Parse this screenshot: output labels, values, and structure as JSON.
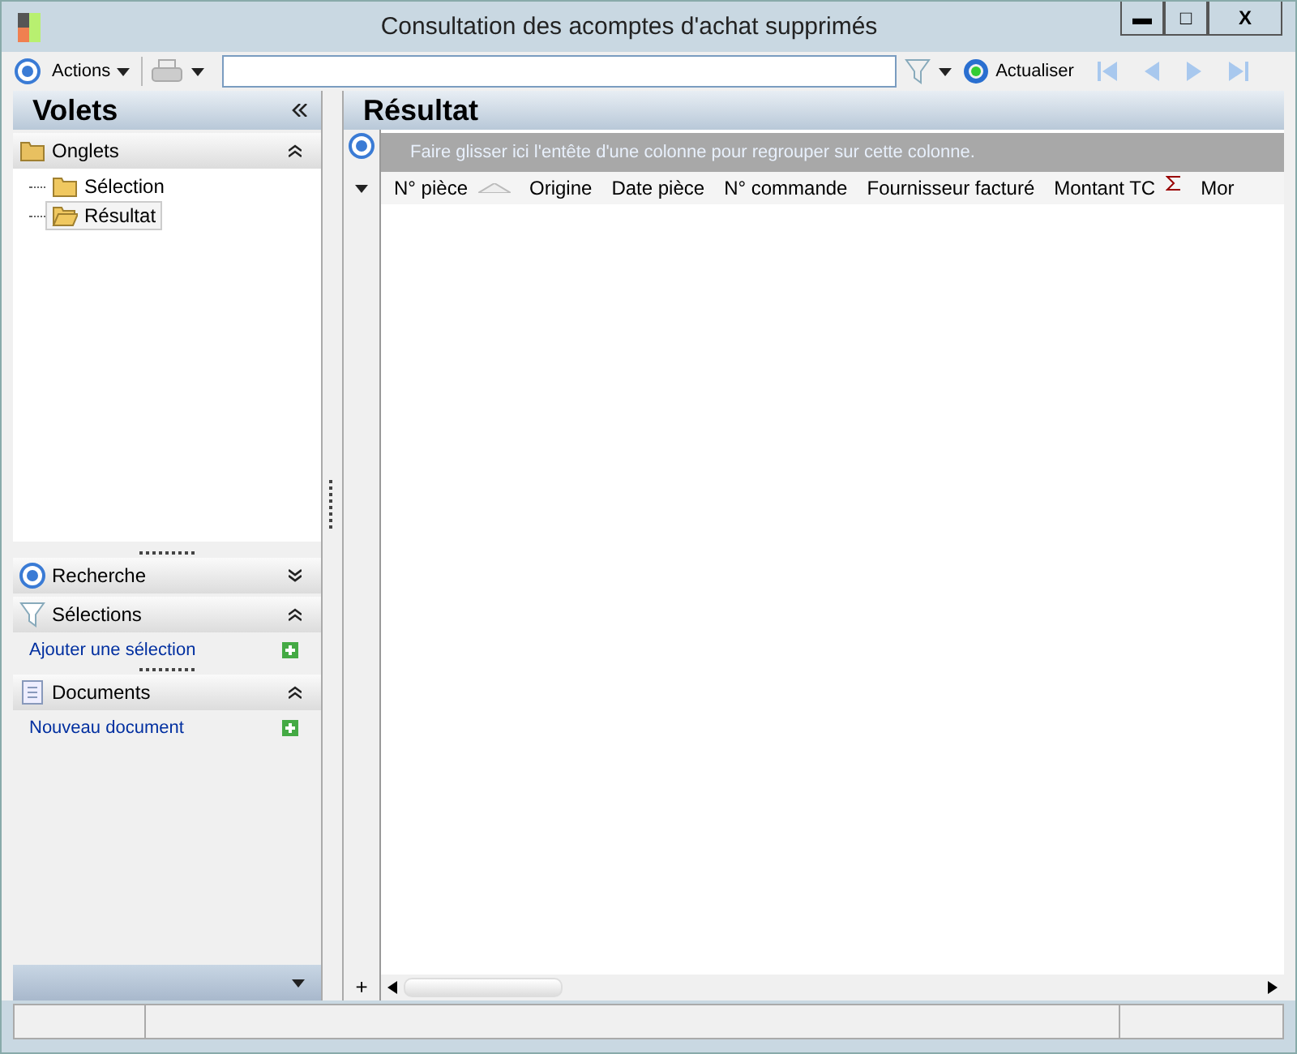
{
  "window": {
    "title": "Consultation des acomptes d'achat supprimés",
    "controls": [
      "▬",
      "□",
      "X"
    ]
  },
  "toolbar": {
    "actions": "Actions",
    "refresh": "Actualiser"
  },
  "left_pane": {
    "title": "Volets",
    "sections": [
      {
        "kind": "tree",
        "title": "Onglets",
        "expanded": true,
        "items": [
          {
            "label": "Sélection",
            "selected": false
          },
          {
            "label": "Résultat",
            "selected": true
          }
        ]
      },
      {
        "kind": "search",
        "title": "Recherche",
        "expanded": false
      },
      {
        "kind": "filter",
        "title": "Sélections",
        "expanded": true,
        "link": "Ajouter une sélection"
      },
      {
        "kind": "document",
        "title": "Documents",
        "expanded": true,
        "link": "Nouveau document"
      }
    ]
  },
  "result": {
    "title": "Résultat",
    "group_hint": "Faire glisser ici l'entête d'une colonne pour regrouper sur cette colonne.",
    "columns": [
      {
        "label": "N° pièce",
        "sorted": true
      },
      {
        "label": "Origine"
      },
      {
        "label": "Date pièce"
      },
      {
        "label": "N° commande"
      },
      {
        "label": "Fournisseur facturé"
      },
      {
        "label": "Montant TC",
        "sum": true
      },
      {
        "label": "Mor"
      }
    ],
    "add": "+"
  }
}
